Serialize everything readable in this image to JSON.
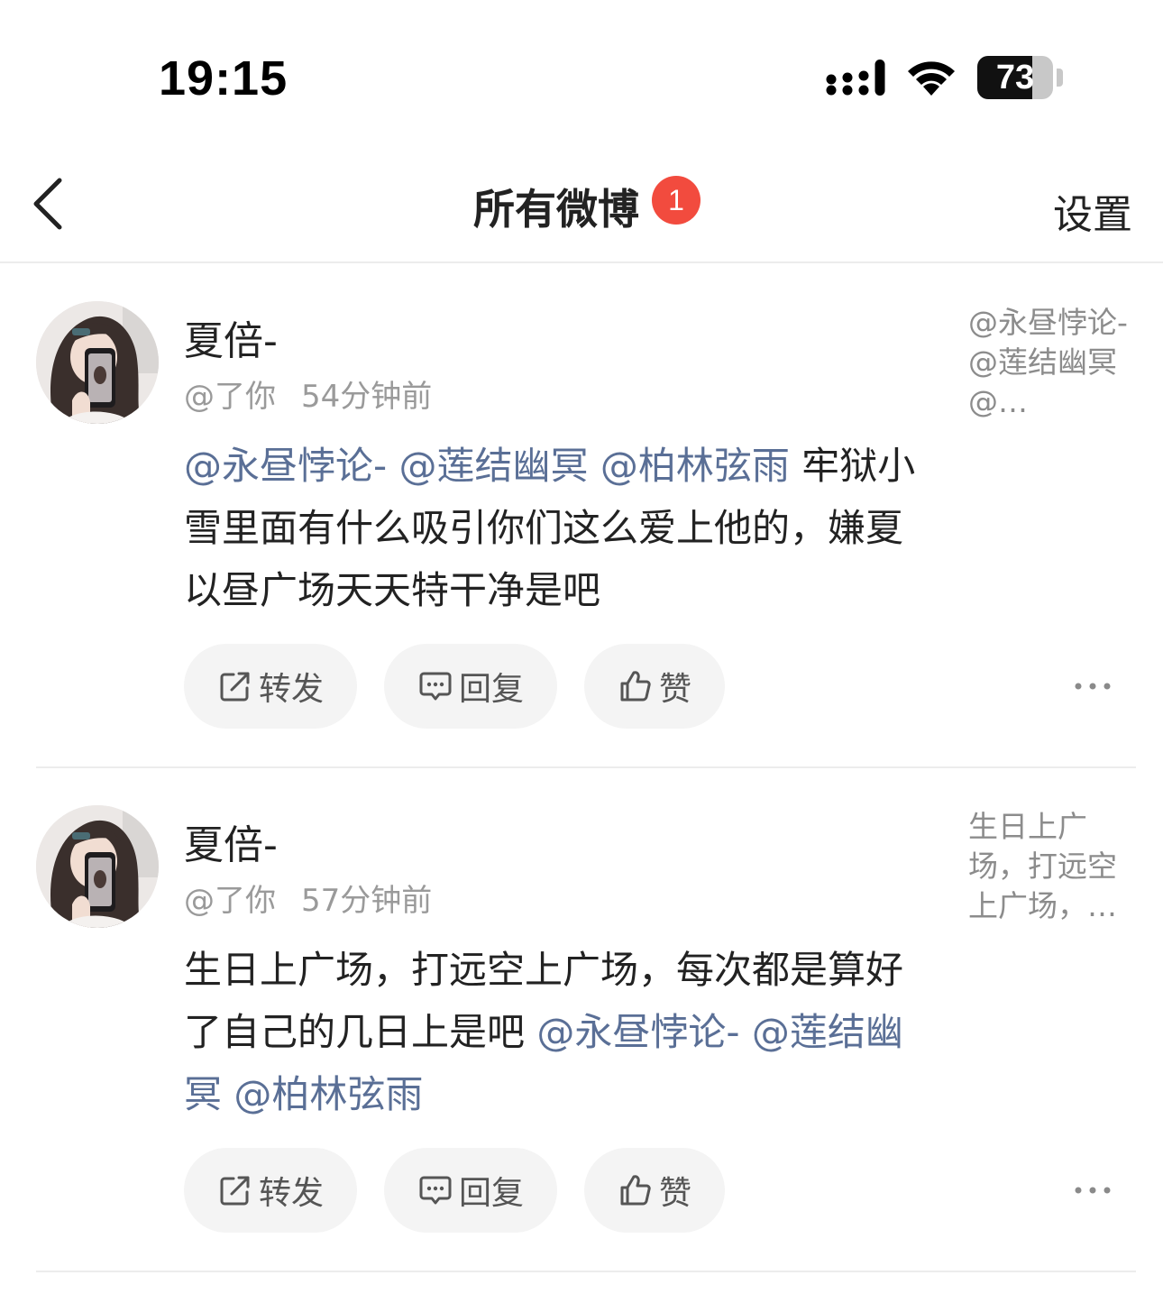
{
  "status_bar": {
    "time": "19:15",
    "battery": "73",
    "battery_level": 0.73
  },
  "nav": {
    "title": "所有微博",
    "badge": "1",
    "settings": "设置"
  },
  "posts": [
    {
      "username": "夏倍-",
      "handle": "@了你",
      "time": "54分钟前",
      "content_segments": [
        {
          "text": "@永昼悖论- ",
          "mention": true
        },
        {
          "text": "@莲结幽冥 ",
          "mention": true
        },
        {
          "text": "@柏林弦雨",
          "mention": true
        },
        {
          "text": " 牢狱小雪里面有什么吸引你们这么爱上他的，嫌夏以昼广场天天特干净是吧",
          "mention": false
        }
      ],
      "preview": "@永昼悖论- @莲结幽冥 @…",
      "actions": {
        "repost": "转发",
        "reply": "回复",
        "like": "赞"
      }
    },
    {
      "username": "夏倍-",
      "handle": "@了你",
      "time": "57分钟前",
      "content_segments": [
        {
          "text": "生日上广场，打远空上广场，每次都是算好了自己的几日上是吧 ",
          "mention": false
        },
        {
          "text": "@永昼悖论- ",
          "mention": true
        },
        {
          "text": "@莲结幽冥 ",
          "mention": true
        },
        {
          "text": "@柏林弦雨",
          "mention": true
        }
      ],
      "preview": "生日上广场，打远空上广场，…",
      "actions": {
        "repost": "转发",
        "reply": "回复",
        "like": "赞"
      }
    }
  ]
}
